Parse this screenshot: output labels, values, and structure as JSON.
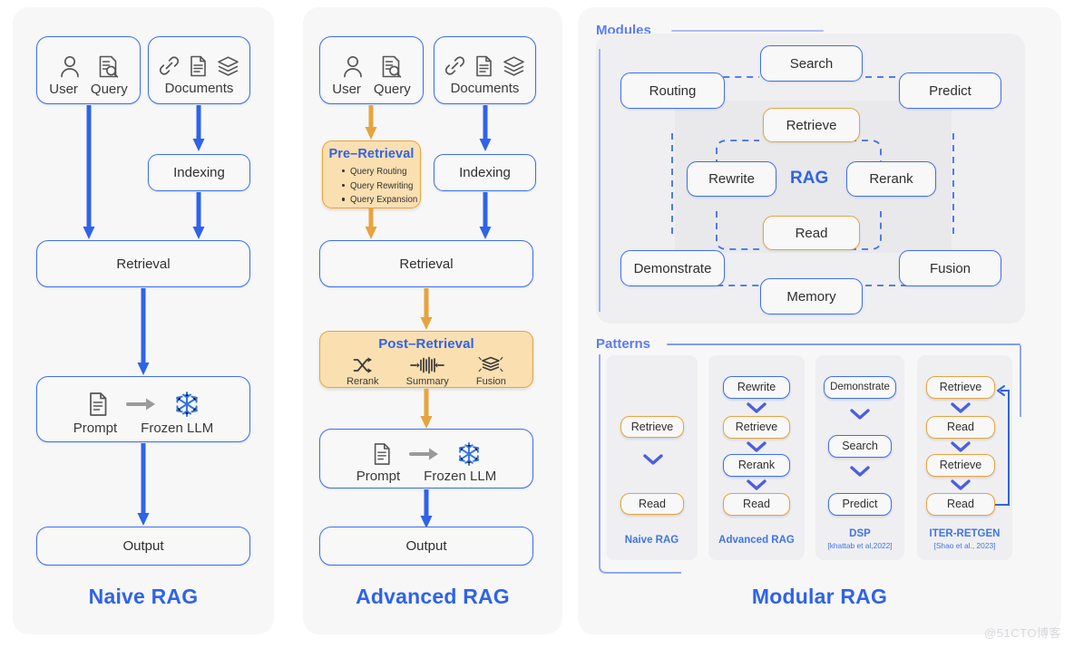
{
  "watermark": "@51CTO博客",
  "colors": {
    "blue": "#3c6ef0",
    "blue_text": "#2f63e8",
    "orange": "#e8a33d",
    "orange_fill": "#fadfb0",
    "panel_bg": "#f7f7f8",
    "module_bg": "#efeff1",
    "rag_inner_bg": "#e9e9eb"
  },
  "naive": {
    "title": "Naive RAG",
    "source_box": {
      "icons": [
        "user-icon",
        "query-icon"
      ],
      "labels": [
        "User",
        "Query"
      ]
    },
    "documents_box": {
      "icons": [
        "link-icon",
        "document-icon",
        "layers-icon"
      ],
      "label": "Documents"
    },
    "indexing": "Indexing",
    "retrieval": "Retrieval",
    "generation": {
      "prompt_label": "Prompt",
      "prompt_icon": "document-icon",
      "arrow_icon": "arrow-right-icon",
      "llm_icon": "snowflake-icon",
      "llm_label": "Frozen LLM"
    },
    "output": "Output"
  },
  "advanced": {
    "title": "Advanced RAG",
    "source_box": {
      "icons": [
        "user-icon",
        "query-icon"
      ],
      "labels": [
        "User",
        "Query"
      ]
    },
    "documents_box": {
      "icons": [
        "link-icon",
        "document-icon",
        "layers-icon"
      ],
      "label": "Documents"
    },
    "pre_retrieval": {
      "title": "Pre–Retrieval",
      "items": [
        "Query Routing",
        "Query Rewriting",
        "Query Expansion"
      ]
    },
    "indexing": "Indexing",
    "retrieval": "Retrieval",
    "post_retrieval": {
      "title": "Post–Retrieval",
      "items": [
        {
          "label": "Rerank",
          "icon": "shuffle-icon"
        },
        {
          "label": "Summary",
          "icon": "compress-icon"
        },
        {
          "label": "Fusion",
          "icon": "fusion-layers-icon"
        }
      ]
    },
    "generation": {
      "prompt_label": "Prompt",
      "prompt_icon": "document-icon",
      "arrow_icon": "arrow-right-icon",
      "llm_icon": "snowflake-icon",
      "llm_label": "Frozen LLM"
    },
    "output": "Output"
  },
  "modular": {
    "title": "Modular RAG",
    "modules_label": "Modules",
    "patterns_label": "Patterns",
    "rag_word": "RAG",
    "modules": {
      "search": "Search",
      "routing": "Routing",
      "predict": "Predict",
      "retrieve": "Retrieve",
      "rewrite": "Rewrite",
      "rerank": "Rerank",
      "read": "Read",
      "demonstrate": "Demonstrate",
      "fusion": "Fusion",
      "memory": "Memory"
    },
    "patterns": [
      {
        "name": "Naive RAG",
        "citation": "",
        "steps": [
          {
            "label": "Retrieve",
            "style": "orange"
          },
          {
            "label": "Read",
            "style": "orange"
          }
        ]
      },
      {
        "name": "Advanced RAG",
        "citation": "",
        "steps": [
          {
            "label": "Rewrite",
            "style": "blue"
          },
          {
            "label": "Retrieve",
            "style": "orange"
          },
          {
            "label": "Rerank",
            "style": "blue"
          },
          {
            "label": "Read",
            "style": "orange"
          }
        ]
      },
      {
        "name": "DSP",
        "citation": "[khattab et al,2022]",
        "steps": [
          {
            "label": "Demonstrate",
            "style": "blue"
          },
          {
            "label": "Search",
            "style": "blue"
          },
          {
            "label": "Predict",
            "style": "blue"
          }
        ]
      },
      {
        "name": "ITER-RETGEN",
        "citation": "[Shao et al., 2023]",
        "steps": [
          {
            "label": "Retrieve",
            "style": "orange"
          },
          {
            "label": "Read",
            "style": "orange"
          },
          {
            "label": "Retrieve",
            "style": "orange"
          },
          {
            "label": "Read",
            "style": "orange"
          }
        ]
      }
    ]
  }
}
